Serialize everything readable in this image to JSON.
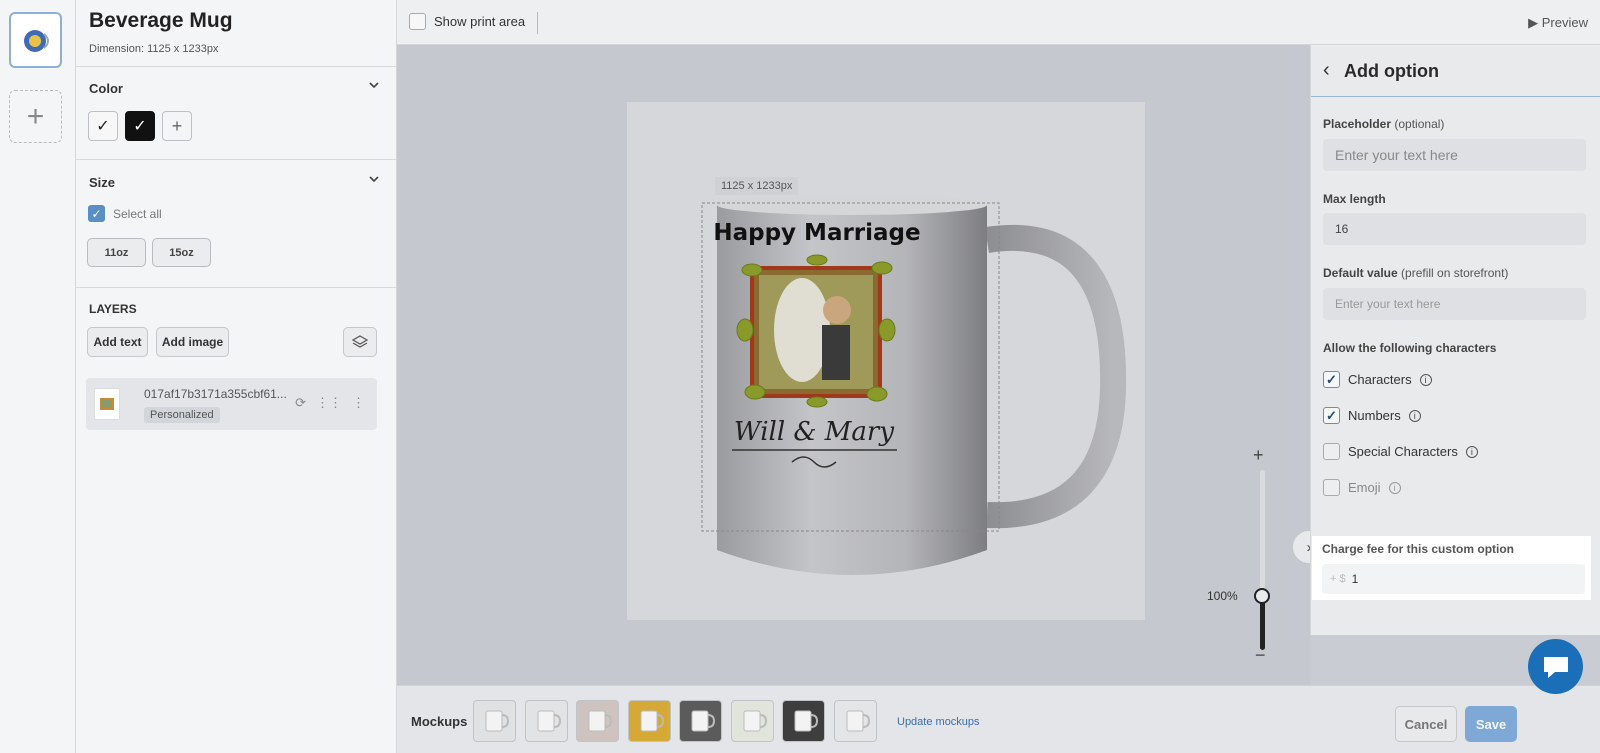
{
  "product": {
    "title": "Beverage Mug",
    "dimension": "Dimension: 1125 x 1233px"
  },
  "rail": {
    "add_symbol": "+"
  },
  "color": {
    "title": "Color",
    "add_symbol": "+"
  },
  "size": {
    "title": "Size",
    "select_all": "Select all",
    "options": [
      "11oz",
      "15oz"
    ]
  },
  "layers": {
    "title": "LAYERS",
    "add_text": "Add text",
    "add_image": "Add image",
    "items": [
      {
        "name": "017af17b3171a355cbf61...",
        "badge": "Personalized"
      }
    ]
  },
  "toolbar": {
    "show_print_area": "Show print area",
    "preview": "▶ Preview"
  },
  "canvas": {
    "dimension_tag": "1125 x 1233px",
    "design_title": "Happy Marriage",
    "design_names": "Will & Mary",
    "zoom_plus": "+",
    "zoom_minus": "−",
    "zoom_label": "100%",
    "zoom_level_fraction": 0.3
  },
  "mockups": {
    "label": "Mockups",
    "update_link": "Update mockups",
    "count": 8
  },
  "footer": {
    "cancel": "Cancel",
    "save": "Save"
  },
  "option_panel": {
    "title": "Add option",
    "placeholder_label": "Placeholder",
    "placeholder_optional": "(optional)",
    "placeholder_value": "Enter your text here",
    "max_length_label": "Max length",
    "max_length_value": "16",
    "default_label": "Default value",
    "default_hint": "(prefill on storefront)",
    "default_placeholder": "Enter your text here",
    "allow_label": "Allow the following characters",
    "char_options": [
      {
        "label": "Characters",
        "checked": true
      },
      {
        "label": "Numbers",
        "checked": true
      },
      {
        "label": "Special Characters",
        "checked": false
      },
      {
        "label": "Emoji",
        "checked": false
      }
    ],
    "fee_label": "Charge fee for this custom option",
    "fee_prefix": "+ $",
    "fee_value": "1"
  },
  "colors": {
    "accent": "#5a8fc6",
    "save_button": "#7ea9d6",
    "chat": "#1a6fb8",
    "link": "#3d6fa8"
  }
}
